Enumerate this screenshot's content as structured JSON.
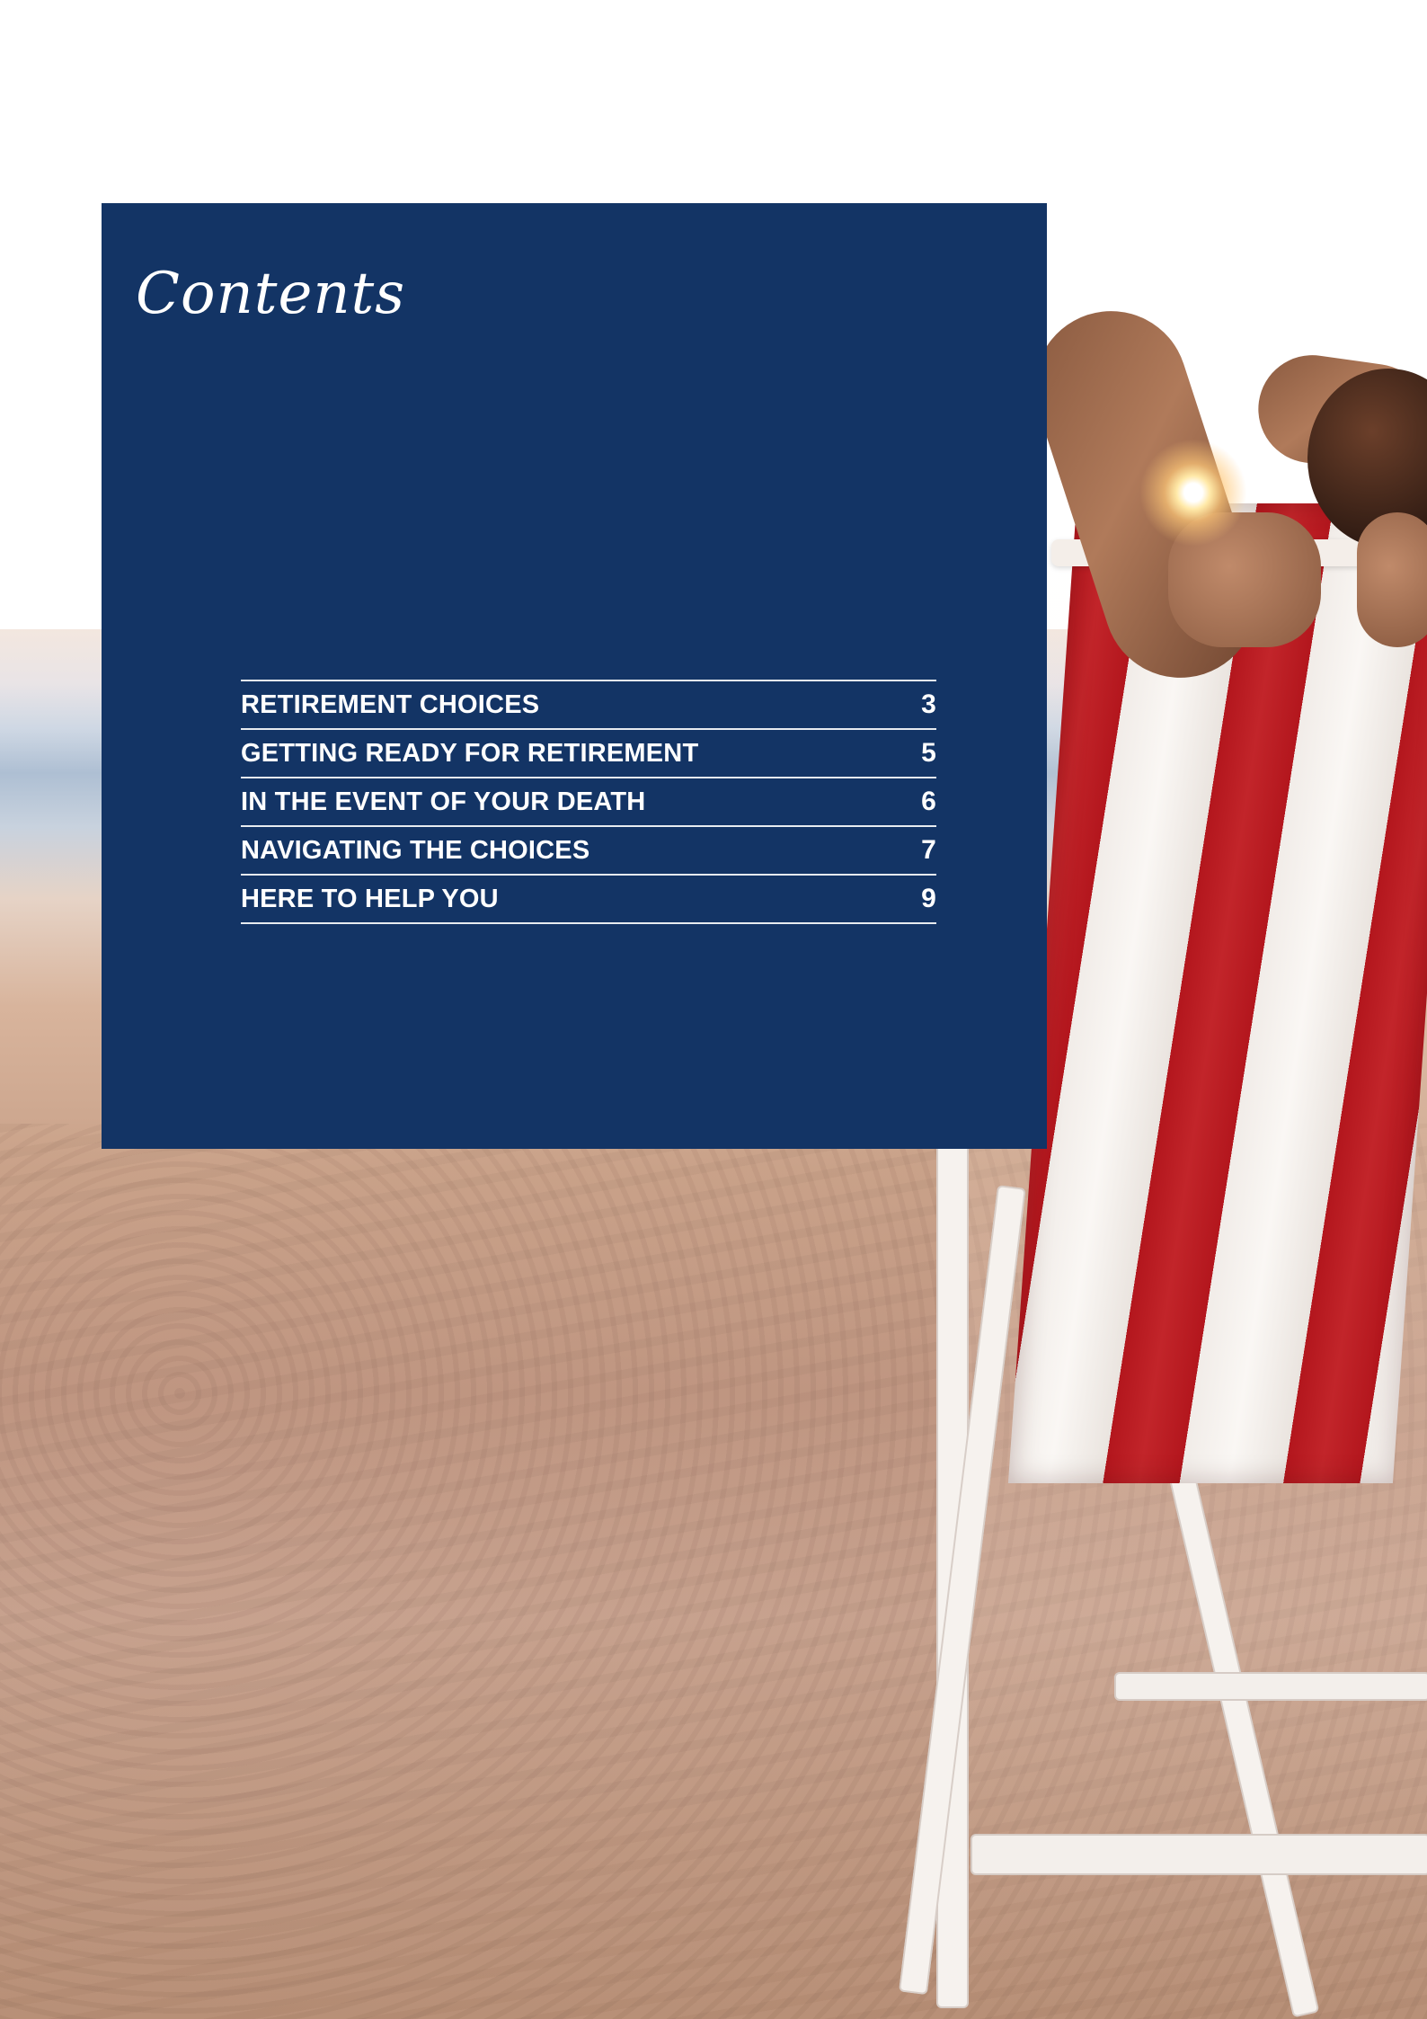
{
  "page": {
    "panel_color": "#133465",
    "accent_red": "#b3161d"
  },
  "contents": {
    "title": "Contents",
    "items": [
      {
        "label": "RETIREMENT CHOICES",
        "page": "3"
      },
      {
        "label": "GETTING READY FOR RETIREMENT",
        "page": "5"
      },
      {
        "label": "IN THE EVENT OF YOUR DEATH",
        "page": "6"
      },
      {
        "label": "NAVIGATING THE CHOICES",
        "page": "7"
      },
      {
        "label": "HERE TO HELP YOU",
        "page": "9"
      }
    ]
  }
}
